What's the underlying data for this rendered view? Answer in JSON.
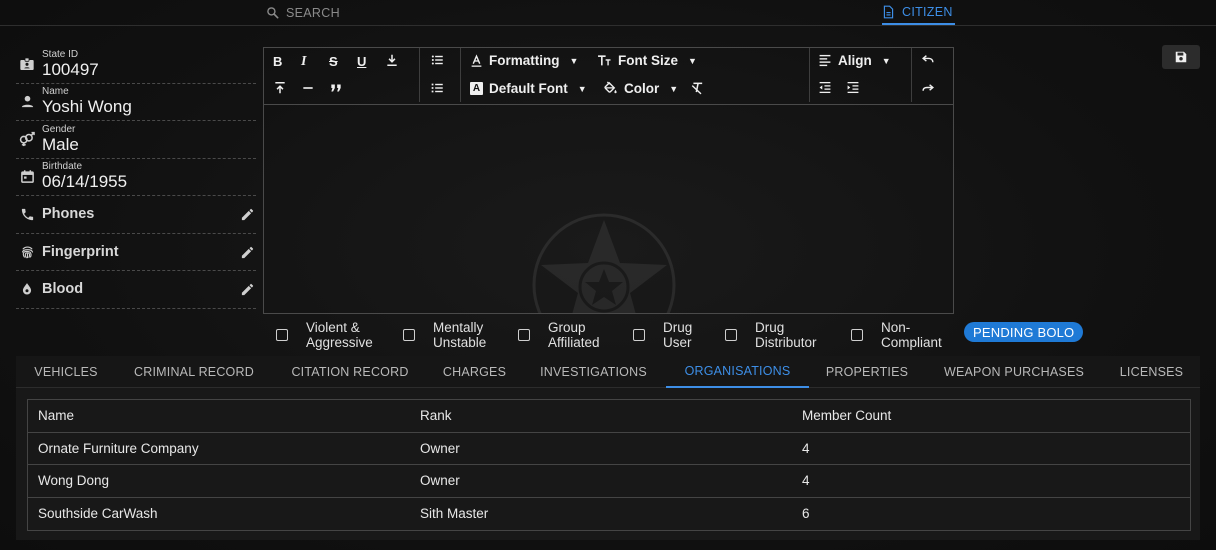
{
  "topbar": {
    "search_label": "SEARCH",
    "citizen_label": "CITIZEN"
  },
  "info": {
    "state_id": {
      "label": "State ID",
      "value": "100497"
    },
    "name": {
      "label": "Name",
      "value": "Yoshi Wong"
    },
    "gender": {
      "label": "Gender",
      "value": "Male"
    },
    "birthdate": {
      "label": "Birthdate",
      "value": "06/14/1955"
    },
    "phones": {
      "label": "Phones"
    },
    "fingerprint": {
      "label": "Fingerprint"
    },
    "blood": {
      "label": "Blood"
    }
  },
  "toolbar": {
    "formatting": "Formatting",
    "font_size": "Font Size",
    "default_font": "Default Font",
    "color": "Color",
    "align": "Align"
  },
  "flags": [
    {
      "line1": "Violent &",
      "line2": "Aggressive"
    },
    {
      "line1": "Mentally",
      "line2": "Unstable"
    },
    {
      "line1": "Group",
      "line2": "Affiliated"
    },
    {
      "line1": "Drug",
      "line2": "User"
    },
    {
      "line1": "Drug",
      "line2": "Distributor"
    },
    {
      "line1": "Non-",
      "line2": "Compliant"
    }
  ],
  "bolo_badge": "PENDING BOLO",
  "tabs": [
    {
      "label": "VEHICLES"
    },
    {
      "label": "CRIMINAL RECORD"
    },
    {
      "label": "CITATION RECORD"
    },
    {
      "label": "CHARGES"
    },
    {
      "label": "INVESTIGATIONS"
    },
    {
      "label": "ORGANISATIONS"
    },
    {
      "label": "PROPERTIES"
    },
    {
      "label": "WEAPON PURCHASES"
    },
    {
      "label": "LICENSES"
    }
  ],
  "table": {
    "headers": [
      "Name",
      "Rank",
      "Member Count"
    ],
    "rows": [
      [
        "Ornate Furniture Company",
        "Owner",
        "4"
      ],
      [
        "Wong Dong",
        "Owner",
        "4"
      ],
      [
        "Southside CarWash",
        "Sith Master",
        "6"
      ]
    ]
  },
  "colors": {
    "accent": "#3d8ee6",
    "badge": "#1f7ad6",
    "background": "#121212"
  }
}
